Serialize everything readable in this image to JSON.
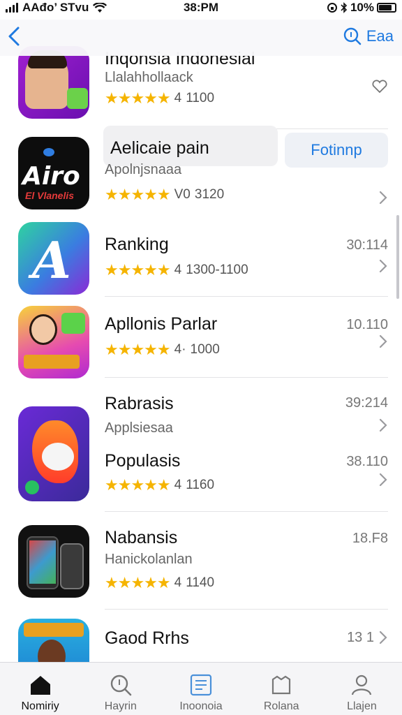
{
  "status_bar": {
    "carrier": "AAđo’ STvu",
    "time": "38:PM",
    "battery": "10%",
    "battery_level": 0.8
  },
  "nav": {
    "back_icon": "chevron-left-icon",
    "search_icon": "search-icon",
    "search_label": "Eaa"
  },
  "apps": [
    {
      "title": "Inqonsia Indonesial",
      "subtitle": "Llalahhollaack",
      "rating_num": "4",
      "reviews": "1100",
      "size": "",
      "action_icon": "heart-icon"
    },
    {
      "title": "Aelicaie pain",
      "subtitle": "Apolnjsnaaa",
      "rating_num": "V0",
      "reviews": "3120",
      "size": "",
      "button": "Fotinnp"
    },
    {
      "title": "Ranking",
      "subtitle": "",
      "rating_num": "4",
      "reviews": "1300-1100",
      "size": "30:114"
    },
    {
      "title": "Apllonis Parlar",
      "subtitle": "",
      "rating_num": "4·",
      "reviews": "1000",
      "size": "10.110"
    },
    {
      "title": "Rabrasis",
      "subtitle": "Applsiesaa",
      "rating_num": "",
      "reviews": "",
      "size": "39:214"
    },
    {
      "title": "Populasis",
      "subtitle": "",
      "rating_num": "4",
      "reviews": "1160",
      "size": "38.110"
    },
    {
      "title": "Nabansis",
      "subtitle": "Hanickolanlan",
      "rating_num": "4",
      "reviews": "1140",
      "size": "18.F8"
    },
    {
      "title": "Gaod Rrhs",
      "subtitle": "",
      "rating_num": "",
      "reviews": "",
      "size": "13 1"
    }
  ],
  "stars": "★★★★★",
  "tabs": [
    {
      "label": "Nomiriy",
      "icon": "home-icon",
      "active": true
    },
    {
      "label": "Hayrin",
      "icon": "search-icon",
      "active": false
    },
    {
      "label": "Inoonoia",
      "icon": "list-icon",
      "active": false
    },
    {
      "label": "Rolana",
      "icon": "box-icon",
      "active": false
    },
    {
      "label": "Llajen",
      "icon": "person-icon",
      "active": false
    }
  ],
  "colors": {
    "accent": "#1f7ae0",
    "star": "#f5b400",
    "tab_bg": "#f5f5f7"
  }
}
